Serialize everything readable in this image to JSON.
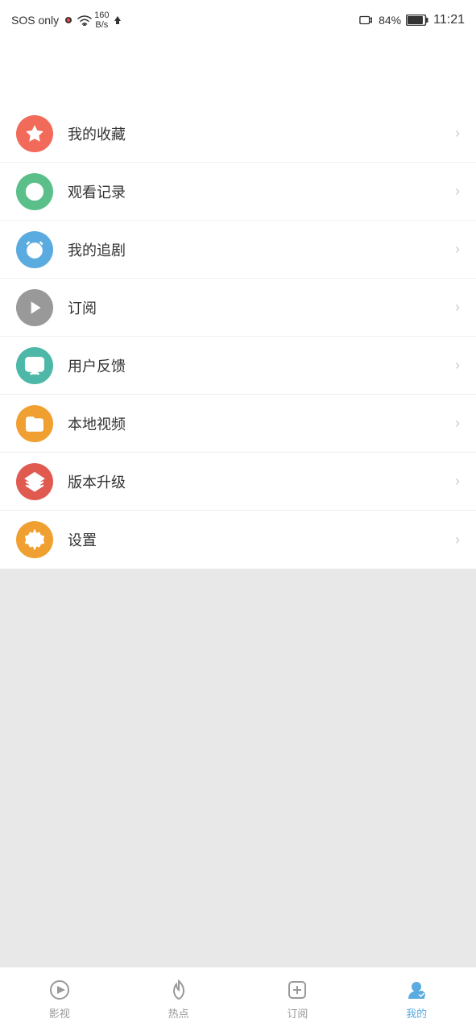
{
  "statusBar": {
    "sos": "SOS only",
    "signal": "!",
    "wifi": "wifi",
    "speed": "160\nB/s",
    "upload": "↑",
    "battery": "84%",
    "time": "11:21"
  },
  "menuItems": [
    {
      "id": "favorites",
      "label": "我的收藏",
      "color": "color-red",
      "icon": "star"
    },
    {
      "id": "history",
      "label": "观看记录",
      "color": "color-green",
      "icon": "clock"
    },
    {
      "id": "series",
      "label": "我的追剧",
      "color": "color-blue",
      "icon": "alarm"
    },
    {
      "id": "subscribe",
      "label": "订阅",
      "color": "color-gray",
      "icon": "play"
    },
    {
      "id": "feedback",
      "label": "用户反馈",
      "color": "color-teal",
      "icon": "chat"
    },
    {
      "id": "local",
      "label": "本地视频",
      "color": "color-orange",
      "icon": "folder"
    },
    {
      "id": "update",
      "label": "版本升级",
      "color": "color-layered",
      "icon": "layers"
    },
    {
      "id": "settings",
      "label": "设置",
      "color": "color-orange2",
      "icon": "gear"
    }
  ],
  "bottomNav": [
    {
      "id": "movies",
      "label": "影视",
      "active": false
    },
    {
      "id": "hot",
      "label": "热点",
      "active": false
    },
    {
      "id": "subscribe",
      "label": "订阅",
      "active": false
    },
    {
      "id": "mine",
      "label": "我的",
      "active": true
    }
  ]
}
